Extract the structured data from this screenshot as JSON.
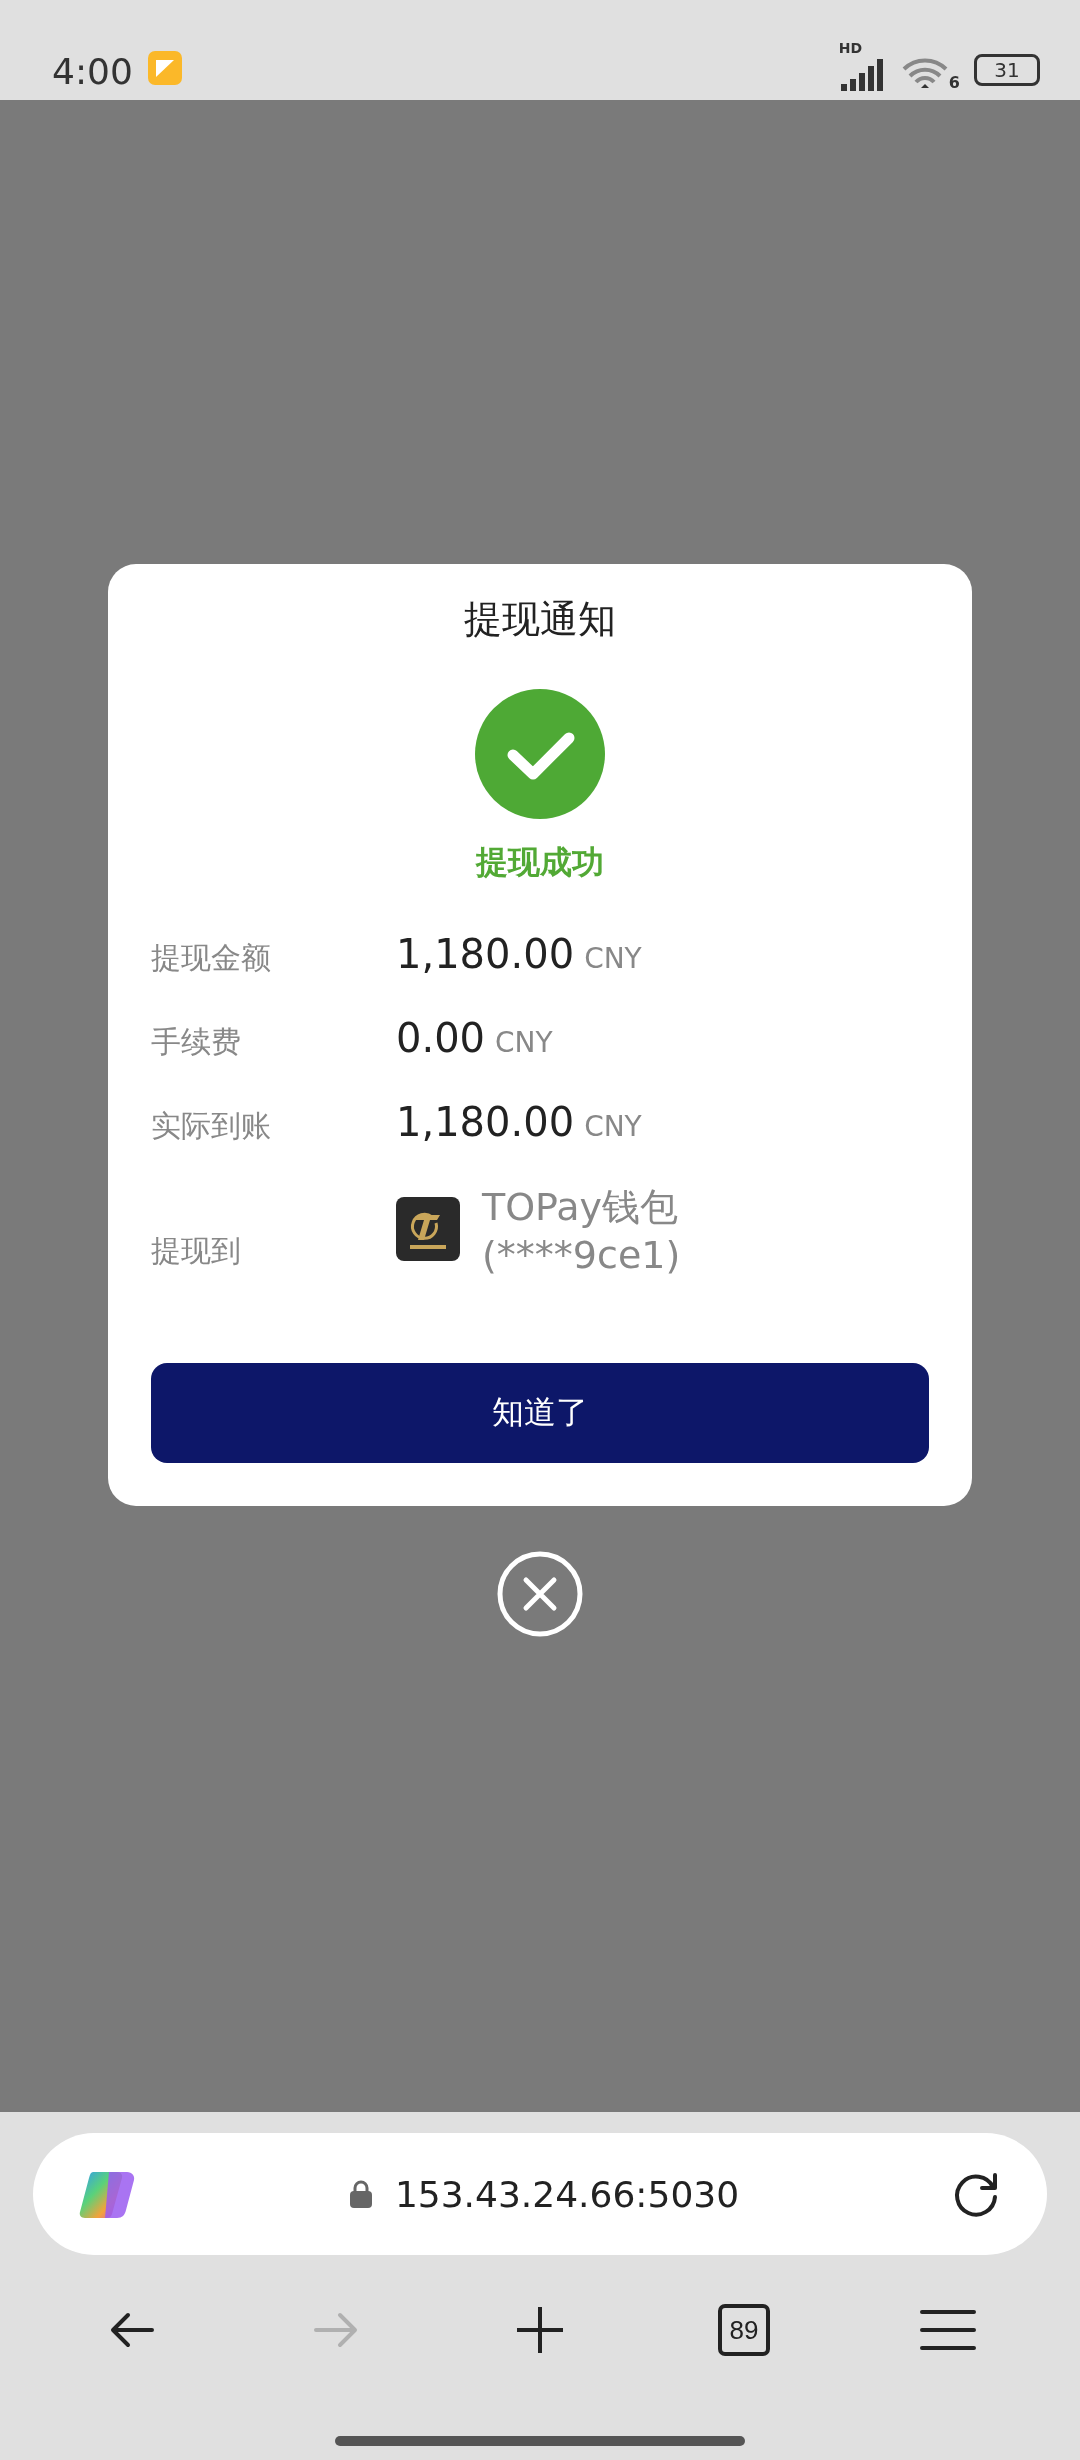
{
  "status_bar": {
    "time": "4:00",
    "network_label": "HD",
    "wifi_label": "6",
    "battery": "31"
  },
  "dialog": {
    "title": "提现通知",
    "status_text": "提现成功",
    "rows": [
      {
        "label": "提现金额",
        "amount": "1,180.00",
        "currency": "CNY"
      },
      {
        "label": "手续费",
        "amount": "0.00",
        "currency": "CNY"
      },
      {
        "label": "实际到账",
        "amount": "1,180.00",
        "currency": "CNY"
      }
    ],
    "destination": {
      "label": "提现到",
      "wallet_name": "TOPay钱包",
      "account": "(****9ce1)"
    },
    "confirm_button": "知道了"
  },
  "browser": {
    "url": "153.43.24.66:5030",
    "nav_buttons": [
      {
        "kind": "back",
        "disabled": false
      },
      {
        "kind": "forward",
        "disabled": true
      },
      {
        "kind": "new_tab",
        "disabled": false
      },
      {
        "kind": "tabs",
        "disabled": false,
        "count": "89"
      },
      {
        "kind": "menu",
        "disabled": false
      }
    ]
  }
}
